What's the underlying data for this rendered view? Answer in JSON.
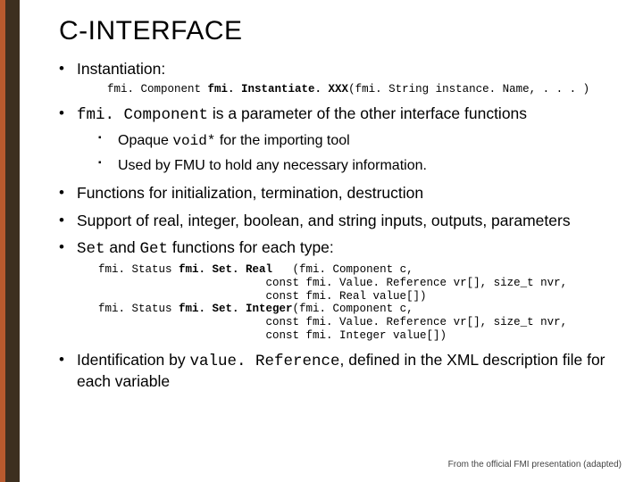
{
  "title": "C-INTERFACE",
  "items": {
    "instantiation": "Instantiation:",
    "instantiation_code": "fmi. Component fmi. Instantiate. XXX(fmi. String instance. Name, . . . )",
    "param_pre": "fmi. Component",
    "param_post": " is a parameter of the other interface functions",
    "sub1_pre": "Opaque ",
    "sub1_mono": "void*",
    "sub1_post": " for the importing tool",
    "sub2": "Used by FMU to hold any necessary information.",
    "funcs": "Functions for initialization, termination, destruction",
    "support": "Support of real, integer, boolean, and string inputs, outputs, parameters",
    "setget_pre_mono1": "Set",
    "setget_mid": " and ",
    "setget_pre_mono2": "Get",
    "setget_post": " functions for each type:",
    "setget_code": "fmi. Status fmi. Set. Real   (fmi. Component c,\n                         const fmi. Value. Reference vr[], size_t nvr,\n                         const fmi. Real value[])\nfmi. Status fmi. Set. Integer(fmi. Component c,\n                         const fmi. Value. Reference vr[], size_t nvr,\n                         const fmi. Integer value[])",
    "ident_pre": "Identification by ",
    "ident_mono": "value. Reference",
    "ident_post": ", defined in the XML description file for each variable"
  },
  "footer": "From the official FMI presentation (adapted)"
}
